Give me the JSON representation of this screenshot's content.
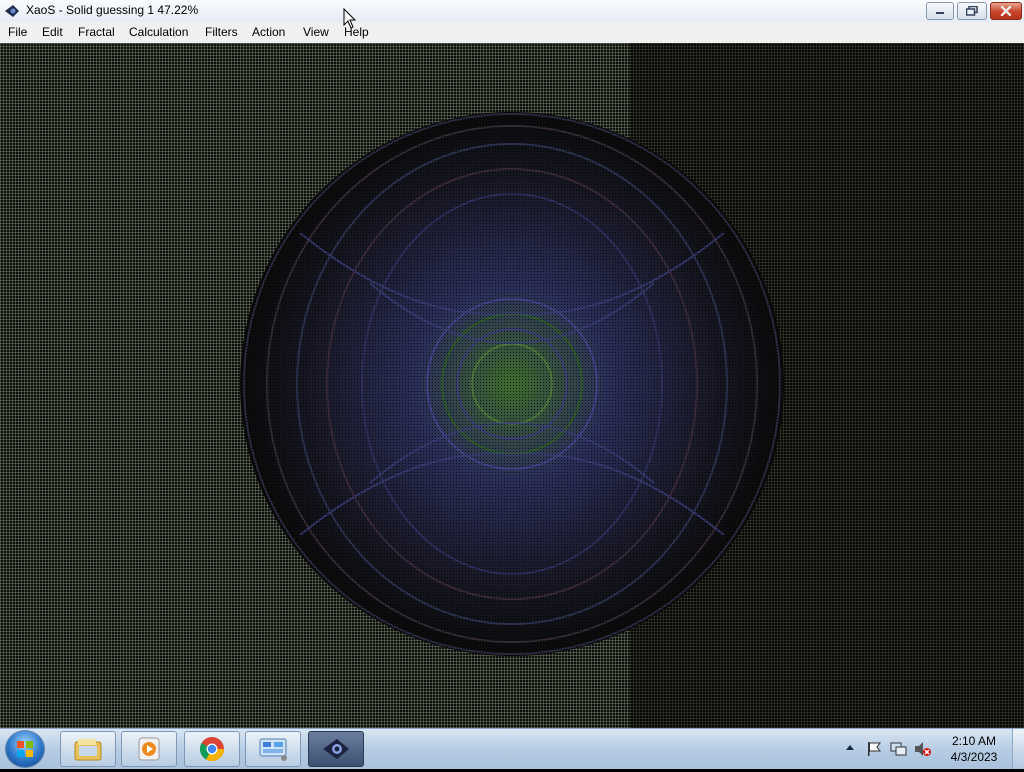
{
  "window": {
    "title": "XaoS - Solid guessing 1 47.22%",
    "controls": {
      "minimize": "minimize",
      "restore": "restore",
      "close": "close"
    }
  },
  "menu": {
    "items": [
      "File",
      "Edit",
      "Fractal",
      "Calculation",
      "Filters",
      "Action",
      "View",
      "Help"
    ]
  },
  "canvas": {
    "content": "fractal-render"
  },
  "taskbar": {
    "buttons": [
      "start-orb",
      "windows-explorer-icon",
      "media-player-icon",
      "chrome-icon",
      "control-panel-icon",
      "xaos-icon"
    ],
    "active": "xaos-icon",
    "tray_icons": [
      "show-hidden-icons",
      "action-center-flag-icon",
      "network-icon",
      "volume-muted-icon"
    ],
    "clock": {
      "time": "2:10 AM",
      "date": "4/3/2023"
    }
  },
  "colors": {
    "titlebar_top": "#fbfcfe",
    "menubar": "#f0f0f0",
    "canvas_bg": "#000000",
    "taskbar": "#b7cde4"
  }
}
